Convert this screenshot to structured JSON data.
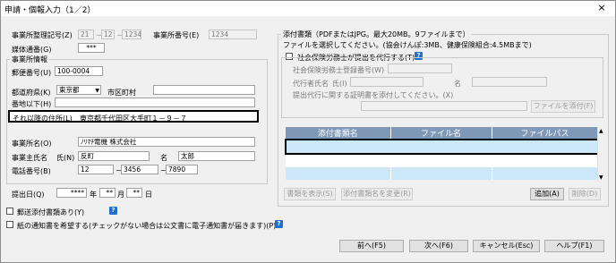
{
  "window": {
    "title": "申請・個報入力（1／2）",
    "close": "×"
  },
  "left": {
    "office_reg_label": "事業所整理記号(Z)",
    "office_reg_1": "21",
    "office_reg_2": "12",
    "office_reg_3": "1234",
    "office_no_label": "事業所番号(E)",
    "office_no_value": "1234",
    "media_label": "媒体通番(G)",
    "media_value": "***",
    "office_info_legend": "事業所情報",
    "postal_label": "郵便番号(U)",
    "postal_value": "100-0004",
    "pref_label": "都道府県(K)",
    "pref_value": "東京都",
    "city_label": "市区町村",
    "city_value": "",
    "banchi_label": "番地以下(H)",
    "banchi_value": "",
    "after_addr_label": "それ以降の住所(L)",
    "after_addr_value": "東京都千代田区大手町１－９－７",
    "office_name_label": "事業所名(O)",
    "office_name_value": "ﾉﾘﾏﾁ電機 株式会社",
    "owner_label": "事業主氏名",
    "owner_sei_label": "氏(N)",
    "owner_sei": "反町",
    "owner_mei_label": "名",
    "owner_mei": "太郎",
    "phone_label": "電話番号(B)",
    "phone_1": "12",
    "phone_2": "3456",
    "phone_3": "7890",
    "submit_date_label": "提出日(Q)",
    "date_year": "****",
    "date_year_unit": "年",
    "date_month": "**",
    "date_month_unit": "月",
    "date_day": "**",
    "date_day_unit": "日",
    "mail_attach_label": "郵送添付書類あり(Y)",
    "paper_notice_label": "紙の通知書を希望する(チェックがない場合は公文書に電子通知書が届きます)(P)",
    "dash": "－",
    "tilde": "~"
  },
  "right": {
    "legend": "添付書類（PDFまたはJPG。最大20MB。9ファイルまで）",
    "note": "ファイルを選択してください。(協会けんぽ:3MB、健康保険組合:4.5MBまで)",
    "sharoushi_check": "社会保険労務士が提出を代行する(T)",
    "sharoushi_no_label": "社会保険労務士登録番号(W)",
    "agent_name_label": "代行者氏名",
    "agent_sei_label": "氏(I)",
    "agent_mei_label": "名",
    "cert_label": "提出代行に関する証明書を添付してください。(X)",
    "attach_file_btn": "ファイルを添付(F)",
    "table_headers": [
      "添付書類名",
      "ファイル名",
      "ファイルパス"
    ],
    "show_doc_btn": "書類を表示(S)",
    "change_doc_btn": "添付書類名を変更(R)",
    "add_btn": "追加(A)",
    "delete_btn": "削除(D)"
  },
  "footer": {
    "prev": "前へ(F5)",
    "next": "次へ(F6)",
    "cancel": "キャンセル(Esc)",
    "help": "ヘルプ(F1)"
  },
  "help_icon_glyph": "?",
  "colors": {
    "table_header": "#7f98b8",
    "selected_row_border": "#000000",
    "table_row_blue": "#cce8f8",
    "help_icon": "#1e6fd0"
  }
}
